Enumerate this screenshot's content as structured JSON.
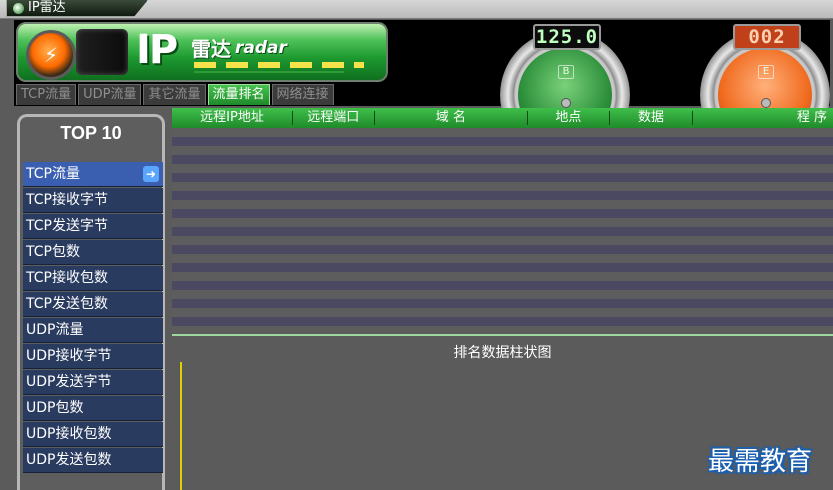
{
  "window": {
    "title": "IP雷达"
  },
  "logo": {
    "ip": "IP",
    "cn": "雷达",
    "en": "radar"
  },
  "tabs": [
    {
      "label": "TCP流量",
      "active": false
    },
    {
      "label": "UDP流量",
      "active": false
    },
    {
      "label": "其它流量",
      "active": false
    },
    {
      "label": "流量排名",
      "active": true
    },
    {
      "label": "网络连接",
      "active": false
    }
  ],
  "gauges": {
    "left": {
      "value": "125.0",
      "letter": "B",
      "color": "#2d8f3b"
    },
    "right": {
      "value": "002",
      "letter": "E",
      "color": "#f06a1e"
    }
  },
  "sidebar": {
    "title": "TOP 10",
    "items": [
      {
        "label": "TCP流量",
        "active": true
      },
      {
        "label": "TCP接收字节"
      },
      {
        "label": "TCP发送字节"
      },
      {
        "label": "TCP包数"
      },
      {
        "label": "TCP接收包数"
      },
      {
        "label": "TCP发送包数"
      },
      {
        "label": "UDP流量"
      },
      {
        "label": "UDP接收字节"
      },
      {
        "label": "UDP发送字节"
      },
      {
        "label": "UDP包数"
      },
      {
        "label": "UDP接收包数"
      },
      {
        "label": "UDP发送包数"
      }
    ]
  },
  "table": {
    "columns": [
      "远程IP地址",
      "远程端口",
      "域 名",
      "地点",
      "数据",
      "程 序"
    ],
    "rows": []
  },
  "chart": {
    "title": "排名数据柱状图"
  },
  "watermark": "最需教育",
  "colors": {
    "accent_green": "#1f8a2a",
    "menu_bg": "#2a3b60",
    "menu_active": "#3a5fb0",
    "chart_axis": "#e0d000"
  }
}
